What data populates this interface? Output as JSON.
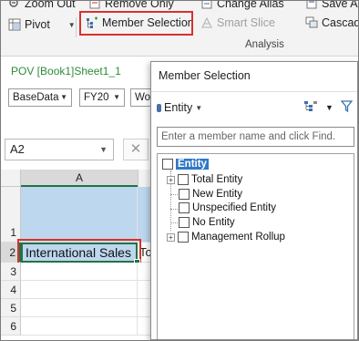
{
  "ribbon": {
    "zoom_out": "Zoom Out",
    "remove_only": "Remove Only",
    "change_alias": "Change Alias",
    "save_as": "Save As",
    "pivot": "Pivot",
    "member_selection": "Member Selection",
    "smart_slice": "Smart Slice",
    "cascade": "Cascade",
    "group_label": "Analysis"
  },
  "pov": {
    "title": "POV [Book1]Sheet1_1",
    "dropdowns": [
      "BaseData",
      "FY20",
      "Wo"
    ]
  },
  "formula_bar": {
    "name_box": "A2"
  },
  "grid": {
    "column_a": "A",
    "rows": [
      "1",
      "2",
      "3",
      "4",
      "5",
      "6"
    ],
    "cell_a2": "International Sales",
    "cell_b2_partial": "To"
  },
  "dialog": {
    "title": "Member Selection",
    "dimension": "Entity",
    "search_placeholder": "Enter a member name and click Find.",
    "tree": {
      "root": "Entity",
      "children": [
        "Total Entity",
        "New Entity",
        "Unspecified Entity",
        "No Entity",
        "Management Rollup"
      ]
    }
  },
  "colors": {
    "excel_green": "#217346",
    "highlight_red": "#d9312d",
    "selection_blue": "#3178c6",
    "pov_green": "#2e8b3a"
  }
}
